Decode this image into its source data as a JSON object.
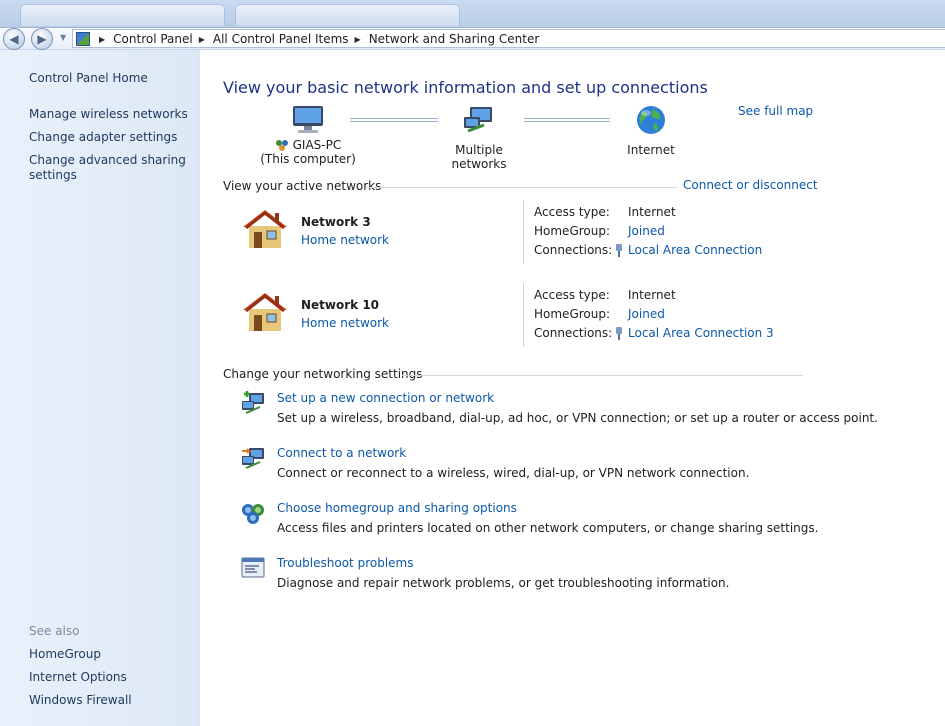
{
  "breadcrumb": {
    "items": [
      "Control Panel",
      "All Control Panel Items",
      "Network and Sharing Center"
    ]
  },
  "sidebar": {
    "home": "Control Panel Home",
    "links": [
      "Manage wireless networks",
      "Change adapter settings",
      "Change advanced sharing",
      "settings"
    ],
    "see_also_label": "See also",
    "see_also": [
      "HomeGroup",
      "Internet Options",
      "Windows Firewall"
    ]
  },
  "main": {
    "title": "View your basic network information and set up connections",
    "see_full_map": "See full map",
    "map": {
      "computer_name": "GIAS-PC",
      "computer_sub": "(This computer)",
      "middle": "Multiple networks",
      "internet": "Internet"
    },
    "active_networks": {
      "heading": "View your active networks",
      "connect_link": "Connect or disconnect",
      "networks": [
        {
          "name": "Network  3",
          "type": "Home network",
          "access_label": "Access type:",
          "access_value": "Internet",
          "homegroup_label": "HomeGroup:",
          "homegroup_value": "Joined",
          "connections_label": "Connections:",
          "connection_value": "Local Area Connection"
        },
        {
          "name": "Network  10",
          "type": "Home network",
          "access_label": "Access type:",
          "access_value": "Internet",
          "homegroup_label": "HomeGroup:",
          "homegroup_value": "Joined",
          "connections_label": "Connections:",
          "connection_value": "Local Area Connection 3"
        }
      ]
    },
    "settings": {
      "heading": "Change your networking settings",
      "tasks": [
        {
          "title": "Set up a new connection or network",
          "desc": "Set up a wireless, broadband, dial-up, ad hoc, or VPN connection; or set up a router or access point."
        },
        {
          "title": "Connect to a network",
          "desc": "Connect or reconnect to a wireless, wired, dial-up, or VPN network connection."
        },
        {
          "title": "Choose homegroup and sharing options",
          "desc": "Access files and printers located on other network computers, or change sharing settings."
        },
        {
          "title": "Troubleshoot problems",
          "desc": "Diagnose and repair network problems, or get troubleshooting information."
        }
      ]
    }
  },
  "colors": {
    "link": "#0b58a8",
    "title": "#1e3287",
    "sidebar_bg": "#e9f1fb"
  }
}
